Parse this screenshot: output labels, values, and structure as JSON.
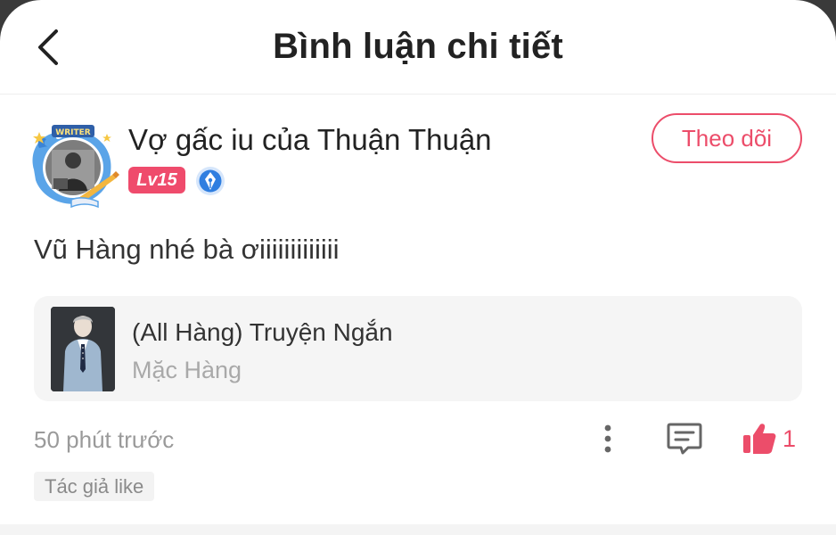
{
  "header": {
    "title": "Bình luận chi tiết",
    "back_icon": "chevron-left-icon"
  },
  "comment": {
    "username": "Vợ gấc iu của Thuận Thuận",
    "avatar_badge": "WRITER",
    "level": "Lv15",
    "writer_badge_icon": "pen-nib-icon",
    "follow_label": "Theo dõi",
    "text": "Vũ Hàng nhé bà ơiiiiiiiiiiiii",
    "time": "50 phút trước",
    "like_count": "1",
    "author_liked_tag": "Tác giả like"
  },
  "story": {
    "title": "(All Hàng) Truyện Ngắn",
    "author": "Mặc Hàng"
  },
  "colors": {
    "accent": "#ec4d6a",
    "level_badge": "#ef4b6c",
    "card_bg": "#f5f5f5",
    "muted_text": "#9a9a9a"
  },
  "icons": {
    "more": "more-vertical-icon",
    "reply": "comment-bubble-icon",
    "like": "thumbs-up-icon"
  }
}
